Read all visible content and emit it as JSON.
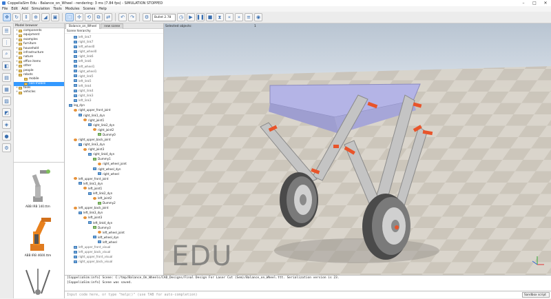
{
  "window": {
    "title": "CoppeliaSim Edu - Balance_on_Wheel - rendering: 3 ms (7.84 fps) - SIMULATION STOPPED",
    "controls": [
      "–",
      "□",
      "✕"
    ]
  },
  "menu": [
    "File",
    "Edit",
    "Add",
    "Simulation",
    "Tools",
    "Modules",
    "Scenes",
    "Help"
  ],
  "toolbar": {
    "engine_select": "Bullet 2.78",
    "accent": "#3a6fb0"
  },
  "model_browser": {
    "header": "Model browser",
    "tree": [
      {
        "label": "components",
        "expand": "+"
      },
      {
        "label": "equipment",
        "expand": "+"
      },
      {
        "label": "examples",
        "expand": "+"
      },
      {
        "label": "furniture",
        "expand": "+"
      },
      {
        "label": "household",
        "expand": "+"
      },
      {
        "label": "infrastructure",
        "expand": "+"
      },
      {
        "label": "nature",
        "expand": "+"
      },
      {
        "label": "office items",
        "expand": "+"
      },
      {
        "label": "other",
        "expand": "+"
      },
      {
        "label": "people",
        "expand": "+"
      },
      {
        "label": "robots",
        "expand": "-"
      },
      {
        "label": "mobile",
        "expand": ""
      },
      {
        "label": "non-mobile",
        "expand": "",
        "selected": true
      },
      {
        "label": "tools",
        "expand": "+"
      },
      {
        "label": "vehicles",
        "expand": "+"
      }
    ],
    "thumbnails": [
      "ABB IRB 140.ttm",
      "ABB IRB 4600.ttm"
    ]
  },
  "scene_hierarchy": {
    "tabs": [
      "Balance_on_Wheel",
      "new scene"
    ],
    "header": "Scene hierarchy",
    "items": [
      {
        "label": "left_link7",
        "icon": "shape"
      },
      {
        "label": "right_link7",
        "icon": "shape"
      },
      {
        "label": "left_wheel0",
        "icon": "shape"
      },
      {
        "label": "right_wheel0",
        "icon": "shape"
      },
      {
        "label": "right_link6",
        "icon": "shape"
      },
      {
        "label": "left_link6",
        "icon": "shape"
      },
      {
        "label": "left_wheel1",
        "icon": "shape"
      },
      {
        "label": "right_wheel1",
        "icon": "shape"
      },
      {
        "label": "right_link5",
        "icon": "shape"
      },
      {
        "label": "left_link5",
        "icon": "shape"
      },
      {
        "label": "left_link4",
        "icon": "shape"
      },
      {
        "label": "right_link4",
        "icon": "shape"
      },
      {
        "label": "right_link3",
        "icon": "shape"
      },
      {
        "label": "left_link3",
        "icon": "shape"
      },
      {
        "label": "leg_dyn",
        "icon": "shape",
        "dark": true
      },
      {
        "label": "right_upper_front_joint",
        "icon": "joint",
        "dark": true
      },
      {
        "label": "right_link1_dyn",
        "icon": "shape",
        "dark": true
      },
      {
        "label": "right_joint1",
        "icon": "joint",
        "dark": true
      },
      {
        "label": "right_link2_dyn",
        "icon": "shape",
        "dark": true
      },
      {
        "label": "right_joint2",
        "icon": "joint",
        "dark": true
      },
      {
        "label": "Dummy0",
        "icon": "dummy",
        "dark": true
      },
      {
        "label": "right_upper_back_joint",
        "icon": "joint",
        "dark": true
      },
      {
        "label": "right_link3_dyn",
        "icon": "shape",
        "dark": true
      },
      {
        "label": "right_joint3",
        "icon": "joint",
        "dark": true
      },
      {
        "label": "right_link4_dyn",
        "icon": "shape",
        "dark": true
      },
      {
        "label": "Dummy1",
        "icon": "dummy",
        "dark": true
      },
      {
        "label": "right_wheel_joint",
        "icon": "joint",
        "dark": true
      },
      {
        "label": "right_wheel_dyn",
        "icon": "shape",
        "dark": true
      },
      {
        "label": "right_wheel",
        "icon": "shape",
        "dark": true
      },
      {
        "label": "left_upper_front_joint",
        "icon": "joint",
        "dark": true
      },
      {
        "label": "left_link1_dyn",
        "icon": "shape",
        "dark": true
      },
      {
        "label": "left_joint1",
        "icon": "joint",
        "dark": true
      },
      {
        "label": "left_link2_dyn",
        "icon": "shape",
        "dark": true
      },
      {
        "label": "left_joint2",
        "icon": "joint",
        "dark": true
      },
      {
        "label": "Dummy2",
        "icon": "dummy",
        "dark": true
      },
      {
        "label": "left_upper_back_joint",
        "icon": "joint",
        "dark": true
      },
      {
        "label": "left_link3_dyn",
        "icon": "shape",
        "dark": true
      },
      {
        "label": "left_joint3",
        "icon": "joint",
        "dark": true
      },
      {
        "label": "left_link4_dyn",
        "icon": "shape",
        "dark": true
      },
      {
        "label": "Dummy3",
        "icon": "dummy",
        "dark": true
      },
      {
        "label": "left_wheel_joint",
        "icon": "joint",
        "dark": true
      },
      {
        "label": "left_wheel_dyn",
        "icon": "shape",
        "dark": true
      },
      {
        "label": "left_wheel",
        "icon": "shape",
        "dark": true
      },
      {
        "label": "left_upper_front_visual",
        "icon": "shape"
      },
      {
        "label": "left_upper_back_visual",
        "icon": "shape"
      },
      {
        "label": "right_upper_front_visual",
        "icon": "shape"
      },
      {
        "label": "right_upper_back_visual",
        "icon": "shape"
      }
    ]
  },
  "viewport": {
    "info_label": "Selected objects:",
    "info_count": "1",
    "watermark": "EDU",
    "body_color": "#b0b0e0",
    "leg_color": "#c4c4c4",
    "joint_color": "#e8542a"
  },
  "console": {
    "lines": [
      "[CoppeliaSim:info]  Scene: C:/tmp/Balance_On_Wheels/CAD_Designs/Final Design For Laser Cut (Sem)/Balance_on_Wheel.ttt. Serialization version is 23.",
      "[CoppeliaSim:info]  Scene was saved."
    ],
    "input_placeholder": "Input code here, or type \"help()\" (use TAB for auto-completion)",
    "language": "Sandbox script"
  }
}
